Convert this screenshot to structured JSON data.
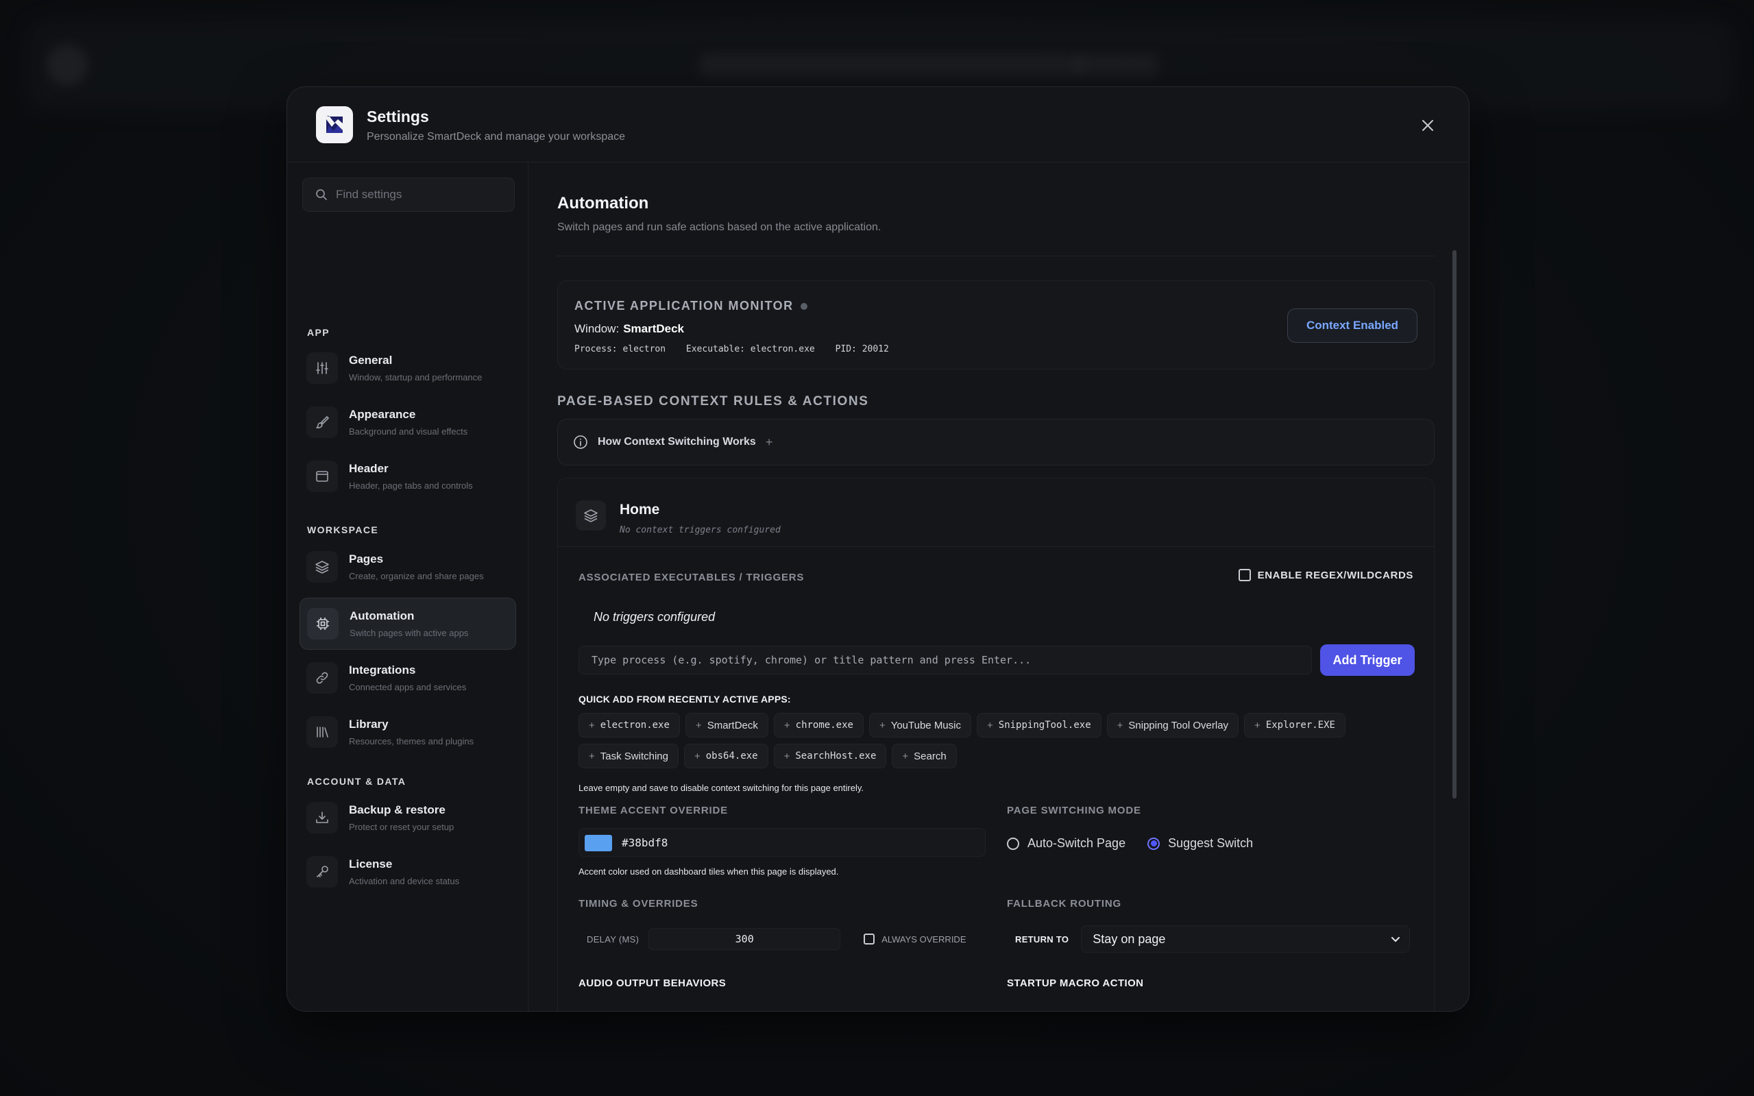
{
  "modal": {
    "title": "Settings",
    "subtitle": "Personalize SmartDeck and manage your workspace"
  },
  "sidebar": {
    "search_placeholder": "Find settings",
    "sections": {
      "app": "APP",
      "workspace": "WORKSPACE",
      "account": "ACCOUNT & DATA"
    },
    "items": [
      {
        "label": "General",
        "desc": "Window, startup and performance",
        "icon": "sliders-icon"
      },
      {
        "label": "Appearance",
        "desc": "Background and visual effects",
        "icon": "paintbrush-icon"
      },
      {
        "label": "Header",
        "desc": "Header, page tabs and controls",
        "icon": "window-icon"
      },
      {
        "label": "Pages",
        "desc": "Create, organize and share pages",
        "icon": "layers-icon"
      },
      {
        "label": "Automation",
        "desc": "Switch pages with active apps",
        "icon": "chip-icon",
        "active": true
      },
      {
        "label": "Integrations",
        "desc": "Connected apps and services",
        "icon": "link-icon"
      },
      {
        "label": "Library",
        "desc": "Resources, themes and plugins",
        "icon": "library-icon"
      },
      {
        "label": "Backup & restore",
        "desc": "Protect or reset your setup",
        "icon": "download-icon"
      },
      {
        "label": "License",
        "desc": "Activation and device status",
        "icon": "key-icon"
      }
    ]
  },
  "main": {
    "title": "Automation",
    "subtitle": "Switch pages and run safe actions based on the active application.",
    "monitor": {
      "title": "ACTIVE APPLICATION MONITOR",
      "window_label": "Window:",
      "window_value": "SmartDeck",
      "process": "Process: electron",
      "executable": "Executable: electron.exe",
      "pid": "PID: 20012",
      "context_button": "Context Enabled"
    },
    "rules_title": "PAGE-BASED CONTEXT RULES & ACTIONS",
    "howto_label": "How Context Switching Works",
    "howto_plus": "+",
    "page": {
      "name": "Home",
      "status": "No context triggers configured",
      "triggers_label": "ASSOCIATED EXECUTABLES / TRIGGERS",
      "regex_label": "ENABLE REGEX/WILDCARDS",
      "no_triggers": "No triggers configured",
      "trigger_placeholder": "Type process (e.g. spotify, chrome) or title pattern and press Enter...",
      "add_trigger": "Add Trigger",
      "quick_add_label": "QUICK ADD FROM RECENTLY ACTIVE APPS:",
      "quick_apps_row1": [
        {
          "label": "electron.exe",
          "mono": true
        },
        {
          "label": "SmartDeck",
          "mono": false
        },
        {
          "label": "chrome.exe",
          "mono": true
        },
        {
          "label": "YouTube Music",
          "mono": false
        },
        {
          "label": "SnippingTool.exe",
          "mono": true
        },
        {
          "label": "Snipping Tool Overlay",
          "mono": false
        },
        {
          "label": "Explorer.EXE",
          "mono": true
        }
      ],
      "quick_apps_row2": [
        {
          "label": "Task Switching",
          "mono": false
        },
        {
          "label": "obs64.exe",
          "mono": true
        },
        {
          "label": "SearchHost.exe",
          "mono": true
        },
        {
          "label": "Search",
          "mono": false
        }
      ],
      "leave_note": "Leave empty and save to disable context switching for this page entirely.",
      "theme_label": "THEME ACCENT OVERRIDE",
      "accent_color": "#38bdf8",
      "accent_note": "Accent color used on dashboard tiles when this page is displayed.",
      "switch_mode_label": "PAGE SWITCHING MODE",
      "mode_auto": "Auto-Switch Page",
      "mode_suggest": "Suggest Switch",
      "timing_label": "TIMING & OVERRIDES",
      "delay_label": "DELAY (MS)",
      "delay_value": "300",
      "always_override": "ALWAYS OVERRIDE",
      "fallback_label": "FALLBACK ROUTING",
      "return_to": "RETURN TO",
      "return_value": "Stay on page",
      "audio_label": "AUDIO OUTPUT BEHAVIORS",
      "startup_label": "STARTUP MACRO ACTION"
    }
  },
  "colors": {
    "accent_button": "#4f53e6",
    "context_text": "#7aa8ff",
    "swatch": "#5aa0f0"
  }
}
